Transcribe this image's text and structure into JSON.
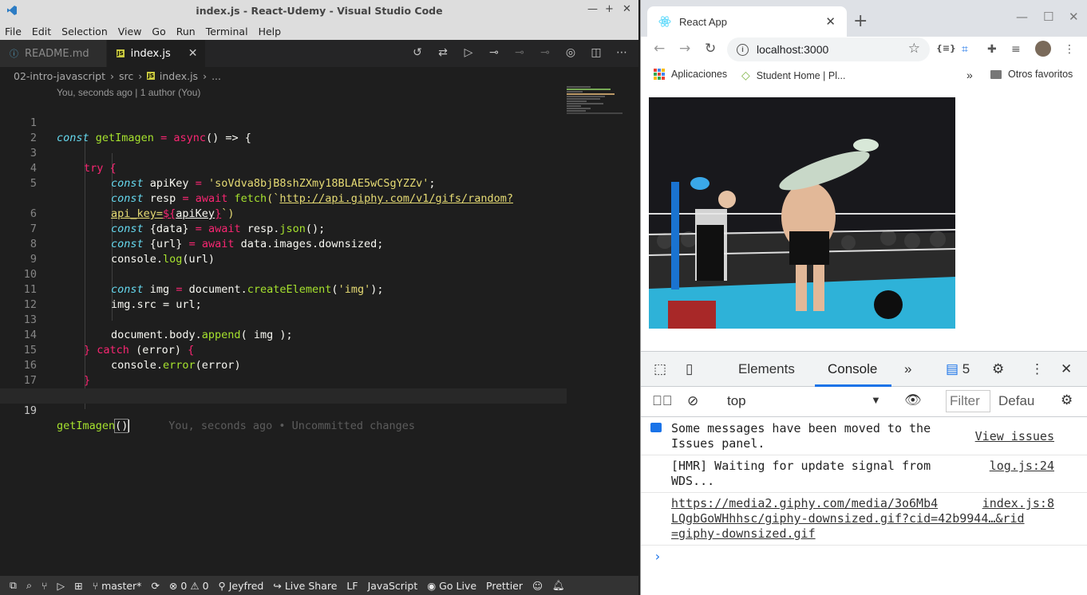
{
  "vscode": {
    "window_title": "index.js - React-Udemy - Visual Studio Code",
    "menu": [
      "File",
      "Edit",
      "Selection",
      "View",
      "Go",
      "Run",
      "Terminal",
      "Help"
    ],
    "tabs": [
      {
        "label": "README.md",
        "active": false
      },
      {
        "label": "index.js",
        "active": true
      }
    ],
    "breadcrumb": [
      "02-intro-javascript",
      "src",
      "index.js",
      "..."
    ],
    "codelens": "You, seconds ago | 1 author (You)",
    "line_numbers": [
      "1",
      "2",
      "3",
      "4",
      "5",
      "",
      "6",
      "7",
      "8",
      "9",
      "10",
      "11",
      "12",
      "13",
      "14",
      "15",
      "16",
      "17",
      "18",
      "19"
    ],
    "code": {
      "l1_const": "const",
      "l1_name": "getImagen",
      "l1_eq": "=",
      "l1_async": "async",
      "l1_rest": "() => {",
      "l3_try": "try",
      "l3_brace": "{",
      "l4_const": "const",
      "l4_name": "apiKey",
      "l4_eq": "=",
      "l4_str": "'soVdva8bjB8shZXmy18BLAE5wCSgYZZv'",
      "l4_end": ";",
      "l5_const": "const",
      "l5_name": "resp",
      "l5_eq": "=",
      "l5_await": "await",
      "l5_fetch": "fetch",
      "l5_open": "(`",
      "l5_url": "http://api.giphy.com/v1/gifs/random?",
      "l5b_url": "api_key=",
      "l5b_interp_open": "${",
      "l5b_var": "apiKey",
      "l5b_interp_close": "}",
      "l5b_close": "`)",
      "l6_const": "const",
      "l6_rest": "{data}",
      "l6_eq": "=",
      "l6_await": "await",
      "l6_obj": "resp.",
      "l6_fn": "json",
      "l6_end": "();",
      "l7_const": "const",
      "l7_rest": "{url}",
      "l7_eq": "=",
      "l7_await": "await",
      "l7_obj": "data.images.downsized;",
      "l8_obj": "console.",
      "l8_fn": "log",
      "l8_end": "(url)",
      "l10_const": "const",
      "l10_name": "img",
      "l10_eq": "=",
      "l10_obj": "document.",
      "l10_fn": "createElement",
      "l10_open": "(",
      "l10_str": "'img'",
      "l10_end": ");",
      "l11": "img.src = url;",
      "l13_obj": "document.body.",
      "l13_fn": "append",
      "l13_end": "( img );",
      "l14_close": "}",
      "l14_catch": "catch",
      "l14_rest": "(error)",
      "l14_open": "{",
      "l15_obj": "console.",
      "l15_fn": "error",
      "l15_end": "(error)",
      "l16": "}",
      "l17": "}",
      "l19_fn": "getImagen",
      "l19_end": "()",
      "l19_blame": "You, seconds ago • Uncommitted changes"
    },
    "status": {
      "branch": "master*",
      "problems_errors": "0",
      "problems_warnings": "0",
      "author": "Jeyfred",
      "live_share": "Live Share",
      "eol": "LF",
      "language": "JavaScript",
      "go_live": "Go Live",
      "prettier": "Prettier"
    },
    "colors": {
      "keyword": "#f92672",
      "function": "#a6e22e",
      "string": "#e6db74",
      "storage": "#66d9ef",
      "background": "#1e1e1e",
      "statusbar": "#333333"
    }
  },
  "chrome": {
    "tab_title": "React App",
    "url": "localhost:3000",
    "bookmarks": [
      "Aplicaciones",
      "Student Home | Pl...",
      "Otros favoritos"
    ],
    "devtools": {
      "tabs": [
        "Elements",
        "Console"
      ],
      "active_tab": "Console",
      "issues_count": "5",
      "context": "top",
      "filter_placeholder": "Filter",
      "levels": "Defau",
      "messages": [
        {
          "text_1": "Some messages have been moved to the",
          "text_2": "Issues panel.",
          "link": "View issues"
        },
        {
          "text_1": "[HMR] Waiting for update signal from",
          "text_2": "WDS...",
          "source": "log.js:24"
        },
        {
          "text_1": "https://media2.giphy.com/media/3o6Mb4",
          "text_2": "LQgbGoWHhhsc/giphy-downsized.gif?cid=42b9944…&rid",
          "text_3": "=giphy-downsized.gif",
          "source": "index.js:8"
        }
      ],
      "prompt": "›"
    }
  }
}
